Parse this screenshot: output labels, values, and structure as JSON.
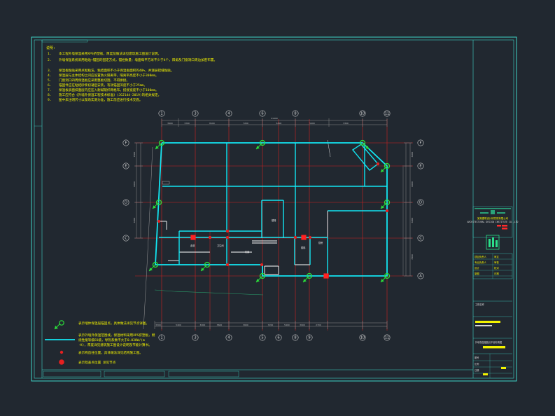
{
  "notes": {
    "heading": "说明:",
    "items": [
      {
        "num": "1.",
        "text": "本工程外墙保温采用XPS挤塑板，厚度及做法详见建筑施工图设计说明。"
      },
      {
        "num": "2.",
        "text": "外墙保温系统采用粘贴+锚固的固定方式，锚栓数量：墙面每平方米不少于4个，阳角及门窗洞口周边加密布置。"
      },
      {
        "num": "3.",
        "text": "保温板粘贴采用点框粘法，粘结面积不小于保温板面积的40%，并逐层错缝粘贴。"
      },
      {
        "num": "4.",
        "text": "保温层与主体结构之间应设置防火隔离带，隔离带高度不小于300mm。"
      },
      {
        "num": "5.",
        "text": "门窗洞口四周保温板应采用整板切割，不得拼接。"
      },
      {
        "num": "6.",
        "text": "锚固件应在粘结砂浆初凝后安装，有效锚固深度不小于25mm。"
      },
      {
        "num": "7.",
        "text": "保温板表面抹面层内应压入耐碱玻纤网格布，搭接宽度不小于100mm。"
      },
      {
        "num": "8.",
        "text": "施工应符合《外墙外保温工程技术标准》(JGJ144-2019)的相关规定。"
      },
      {
        "num": "9.",
        "text": "图中未注明尺寸以现场实测为准，施工前应进行技术交底。"
      }
    ]
  },
  "axes": {
    "top": [
      "1",
      "3",
      "4",
      "6",
      "8",
      "10",
      "11"
    ],
    "bottom": [
      "1",
      "3",
      "4",
      "5",
      "6",
      "8",
      "9",
      "10",
      "11"
    ],
    "left": [
      "F",
      "E",
      "D",
      "C"
    ],
    "right": [
      "F",
      "E",
      "D",
      "C",
      "A"
    ]
  },
  "dimensions": {
    "overall": "41400",
    "top": [
      "3900",
      "7200",
      "8100",
      "7200",
      "6300",
      "5400",
      "3300"
    ],
    "bottom": [
      "3300",
      "5400",
      "6300",
      "3600",
      "3600",
      "7200",
      "5400",
      "3900",
      "2700"
    ],
    "left": [
      "7800",
      "6000",
      "6000"
    ],
    "right": [
      "6000",
      "6000",
      "6000",
      "7800"
    ]
  },
  "rooms": [
    "楼梯",
    "卫生间",
    "机房",
    "楼梯",
    "厨房",
    "走道"
  ],
  "legend": [
    {
      "symbol": "anchor-point",
      "text": "表示墙体保温层锚固点，具体做法详见节点详图。"
    },
    {
      "symbol": "insulation-line",
      "text": "表示外墙外保温范围线，保温材料采用XPS挤塑板，燃烧性能等级B1级，导热系数不大于0.030W/(m·K)，厚度详见建筑施工图设计说明及节能计算书。"
    },
    {
      "symbol": "small-red-dot",
      "text": "表示构造柱位置，具体做法详见结构施工图。"
    },
    {
      "symbol": "large-red-dot",
      "text": "表示检查点位置 详见节点"
    }
  ],
  "titleblock": {
    "company": "某某建筑设计研究院有限公司",
    "company_en": "ARCHITECTURAL DESIGN INSTITUTE CO.,LTD",
    "rows": [
      [
        "项目负责人",
        "审定"
      ],
      [
        "专业负责人",
        "审核"
      ],
      [
        "设计",
        "校对"
      ],
      [
        "制图",
        "日期"
      ]
    ],
    "project_label": "工程名称",
    "drawing_title": "外墙保温锚固点平面布置图",
    "drawing_no_label": "图号",
    "scale_label": "比例",
    "date_label": "日期"
  },
  "colors": {
    "background": "#212830",
    "frame": "#3fd6c8",
    "insulation": "#12e6f2",
    "wall": "#ffffff",
    "grid": "#d22020",
    "dimension": "#8c8c8c",
    "anchor": "#2be03a",
    "text": "#f2f200"
  }
}
